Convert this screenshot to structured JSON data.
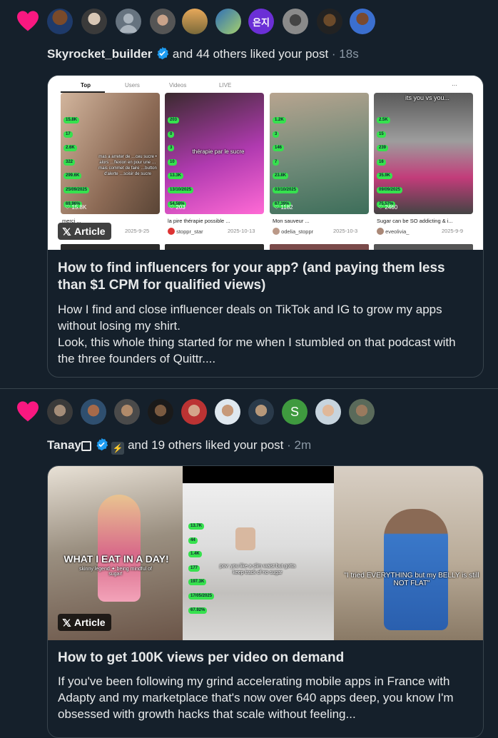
{
  "colors": {
    "bg": "#15202b",
    "like": "#f91880",
    "verified": "#1d9bf0",
    "border": "#38444d",
    "stat_green": "#36e14e"
  },
  "notif1": {
    "user": "Skyrocket_builder",
    "action": "and 44 others liked your post",
    "time": "· 18s",
    "avatar_texts": [
      "",
      "",
      "",
      "",
      "",
      "",
      "은지",
      "",
      "",
      ""
    ],
    "card": {
      "badge": "Article",
      "title": "How to find influencers for your app? (and paying them less than $1 CPM for qualified views)",
      "description": "How I find and close influencer deals on TikTok and IG to grow my apps without losing my shirt.\nLook, this whole thing started for me when I stumbled on that podcast with the three founders of Quittr....",
      "tiktok": {
        "tabs": [
          "Top",
          "Users",
          "Videos",
          "LIVE"
        ],
        "tiles": [
          {
            "stats": [
              "15.8K",
              "17",
              "2.6K",
              "322",
              "299.6K",
              "25/09/2025",
              "69.96%"
            ],
            "overlay": "mas a arreter de …ceu sucre • alors …flexion en pour une …mais commet de faire …button d'alerte …soisir de sucre",
            "views": "15.8K",
            "caption": "merci ...",
            "author": "",
            "date": "2025-9-25"
          },
          {
            "stats": [
              "203",
              "0",
              "3",
              "10",
              "13.3K",
              "13/10/2025",
              "54.58%"
            ],
            "overlay": "thérapie par le sucre",
            "views": "203",
            "caption": "la pire thérapie possible ...",
            "author": "stoppr_star",
            "date": "2025-10-13"
          },
          {
            "stats": [
              "1.2K",
              "3",
              "146",
              "7",
              "23.8K",
              "03/10/2025",
              "67.39%"
            ],
            "overlay": "",
            "views": "1182",
            "caption": "Mon sauveur ...",
            "author": "odelia_stoppr",
            "date": "2025-10-3"
          },
          {
            "stats": [
              "2.5K",
              "15",
              "239",
              "16",
              "35.9K",
              "09/09/2025",
              "75.57%"
            ],
            "overlay": "its you vs you...",
            "views": "2460",
            "caption": "Sugar can be SO addicting & i...",
            "author": "eveolivia_",
            "date": "2025-9-9"
          }
        ]
      }
    }
  },
  "notif2": {
    "user": "Tanay",
    "action": "and 19 others liked your post",
    "time": "· 2m",
    "avatar_texts": [
      "",
      "",
      "",
      "",
      "",
      "",
      "",
      "S",
      "",
      ""
    ],
    "card": {
      "badge": "Article",
      "title": "How to get 100K views per video on demand",
      "description": "If you've been following my grind accelerating mobile apps in France with Adapty and my marketplace that's now over 640 apps deep, you know I'm obsessed with growth hacks that scale without feeling...",
      "panels": {
        "left_big": "WHAT I EAT IN A DAY!",
        "left_small": "skinny legend ✦ being mindful of sugar!",
        "middle_caption": "pov: you like a slim waist but gotta keep track of no sugar",
        "middle_stats": [
          "13.7K",
          "44",
          "1.4K",
          "177",
          "197.3K",
          "17/05/2025",
          "67.92%"
        ],
        "right_caption": "\"I tried EVERYTHING but my BELLY is still NOT FLAT\""
      }
    }
  }
}
